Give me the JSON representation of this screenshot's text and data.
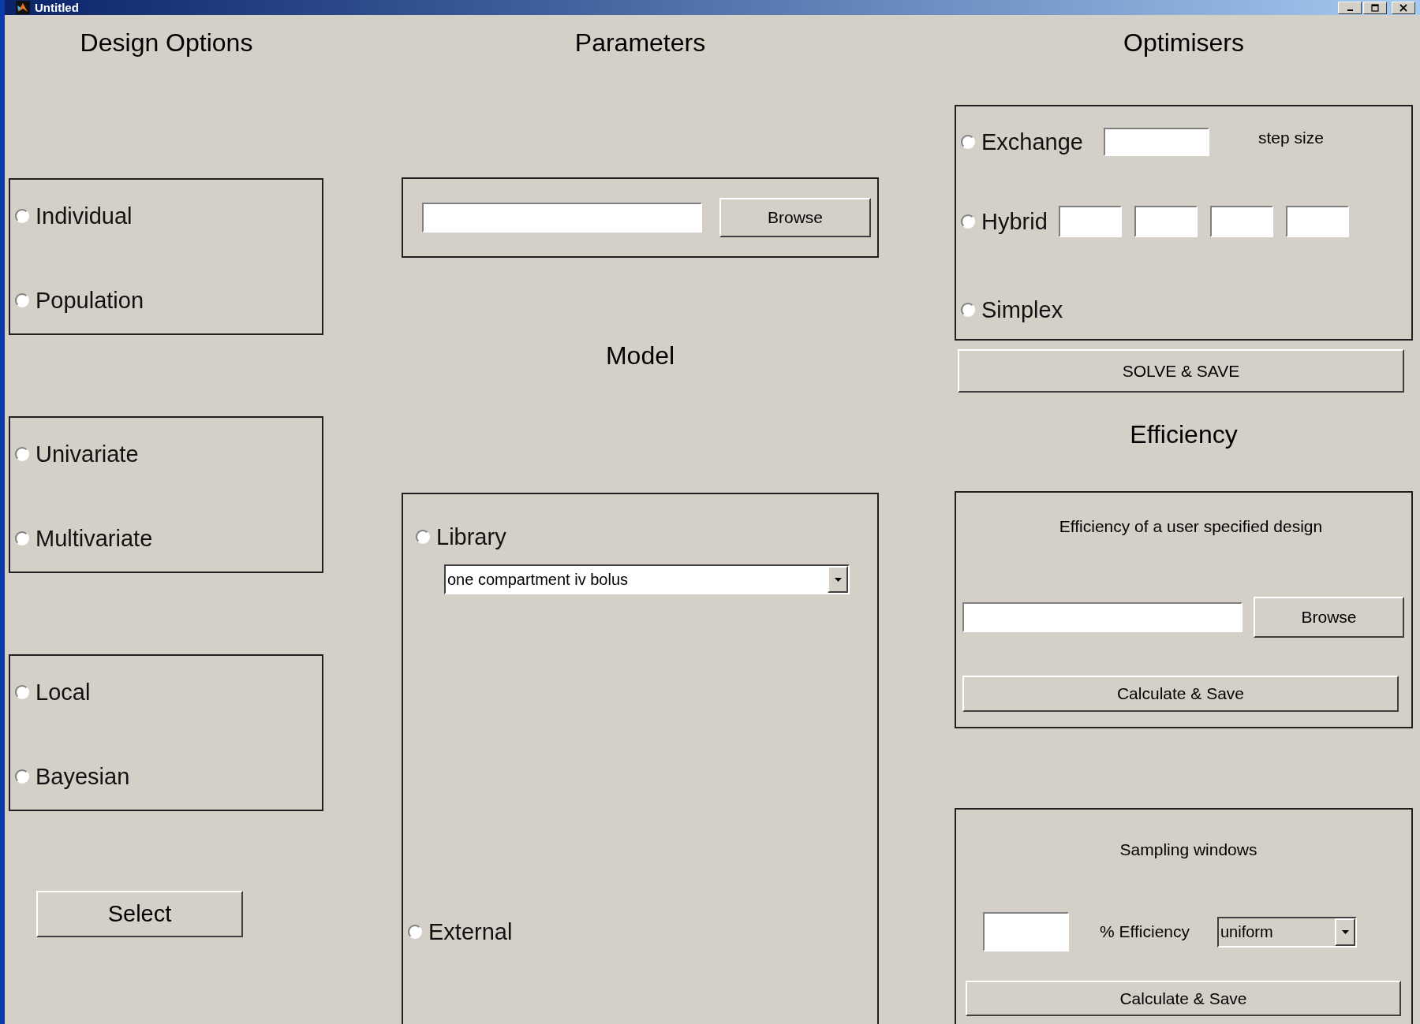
{
  "window": {
    "title": "Untitled"
  },
  "design_options": {
    "heading": "Design Options",
    "groups": [
      {
        "options": [
          {
            "label": "Individual",
            "selected": false
          },
          {
            "label": "Population",
            "selected": false
          }
        ]
      },
      {
        "options": [
          {
            "label": "Univariate",
            "selected": false
          },
          {
            "label": "Multivariate",
            "selected": false
          }
        ]
      },
      {
        "options": [
          {
            "label": "Local",
            "selected": false
          },
          {
            "label": "Bayesian",
            "selected": false
          }
        ]
      }
    ],
    "button": "Select"
  },
  "parameters": {
    "heading": "Parameters",
    "browse_button": "Browse"
  },
  "model": {
    "heading": "Model",
    "options": [
      {
        "label": "Library",
        "selected": false,
        "kind": "library",
        "dropdown": {
          "value": "one compartment iv bolus"
        }
      },
      {
        "label": "External",
        "selected": false,
        "kind": "plain"
      }
    ]
  },
  "optimisers": {
    "heading": "Optimisers",
    "options": [
      {
        "label": "Exchange",
        "selected": false,
        "kind": "exchange",
        "note": "step size"
      },
      {
        "label": "Hybrid",
        "selected": false,
        "kind": "hybrid"
      },
      {
        "label": "Simplex",
        "selected": false,
        "kind": "plain"
      }
    ],
    "button": "SOLVE & SAVE"
  },
  "efficiency": {
    "heading": "Efficiency",
    "user_design": {
      "caption": "Efficiency of a user specified design",
      "browse_button": "Browse",
      "button": "Calculate & Save"
    },
    "sampling_windows": {
      "caption": "Sampling windows",
      "field_label": "% Efficiency",
      "dropdown": {
        "value": "uniform"
      },
      "button": "Calculate & Save"
    }
  }
}
